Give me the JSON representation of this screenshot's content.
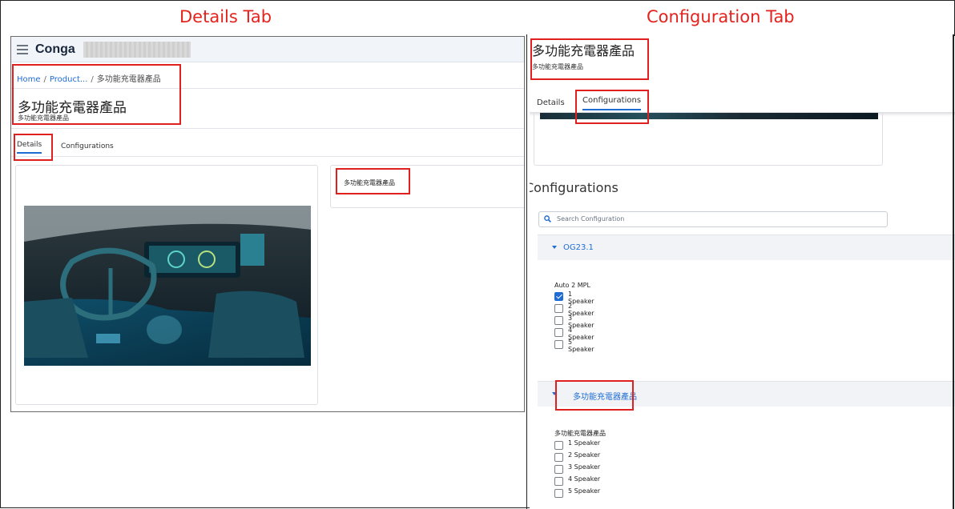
{
  "captions": {
    "left": "Details Tab",
    "right": "Configuration Tab"
  },
  "details_view": {
    "app_logo": "Conga",
    "breadcrumb": {
      "home": "Home",
      "products": "Product...",
      "separator": "/",
      "current": "多功能充電器產品"
    },
    "product_title": "多功能充電器產品",
    "product_subtitle": "多功能充電器產品",
    "tabs": [
      "Details",
      "Configurations"
    ],
    "active_tab": "Details",
    "product_name_field": "多功能充電器產品"
  },
  "configuration_view": {
    "product_title": "多功能充電器產品",
    "product_subtitle": "多功能充電器產品",
    "tabs": [
      "Details",
      "Configurations"
    ],
    "active_tab": "Configurations",
    "section_heading": "Configurations",
    "search_placeholder": "Search Configuration",
    "groups": [
      {
        "header": "OG23.1",
        "title": "Auto 2 MPL",
        "options": [
          {
            "label": "1 Speaker",
            "checked": true
          },
          {
            "label": "2 Speaker",
            "checked": false
          },
          {
            "label": "3 Speaker",
            "checked": false
          },
          {
            "label": "4 Speaker",
            "checked": false
          },
          {
            "label": "5 Speaker",
            "checked": false
          }
        ]
      },
      {
        "header": "多功能充電器產品",
        "title": "多功能充電器產品",
        "options": [
          {
            "label": "1 Speaker",
            "checked": false
          },
          {
            "label": "2 Speaker",
            "checked": false
          },
          {
            "label": "3 Speaker",
            "checked": false
          },
          {
            "label": "4 Speaker",
            "checked": false
          },
          {
            "label": "5 Speaker",
            "checked": false
          }
        ]
      }
    ]
  },
  "colors": {
    "annotation_red": "#e01f1f",
    "link_blue": "#1f6cd3",
    "caption_red": "#e4231e"
  }
}
